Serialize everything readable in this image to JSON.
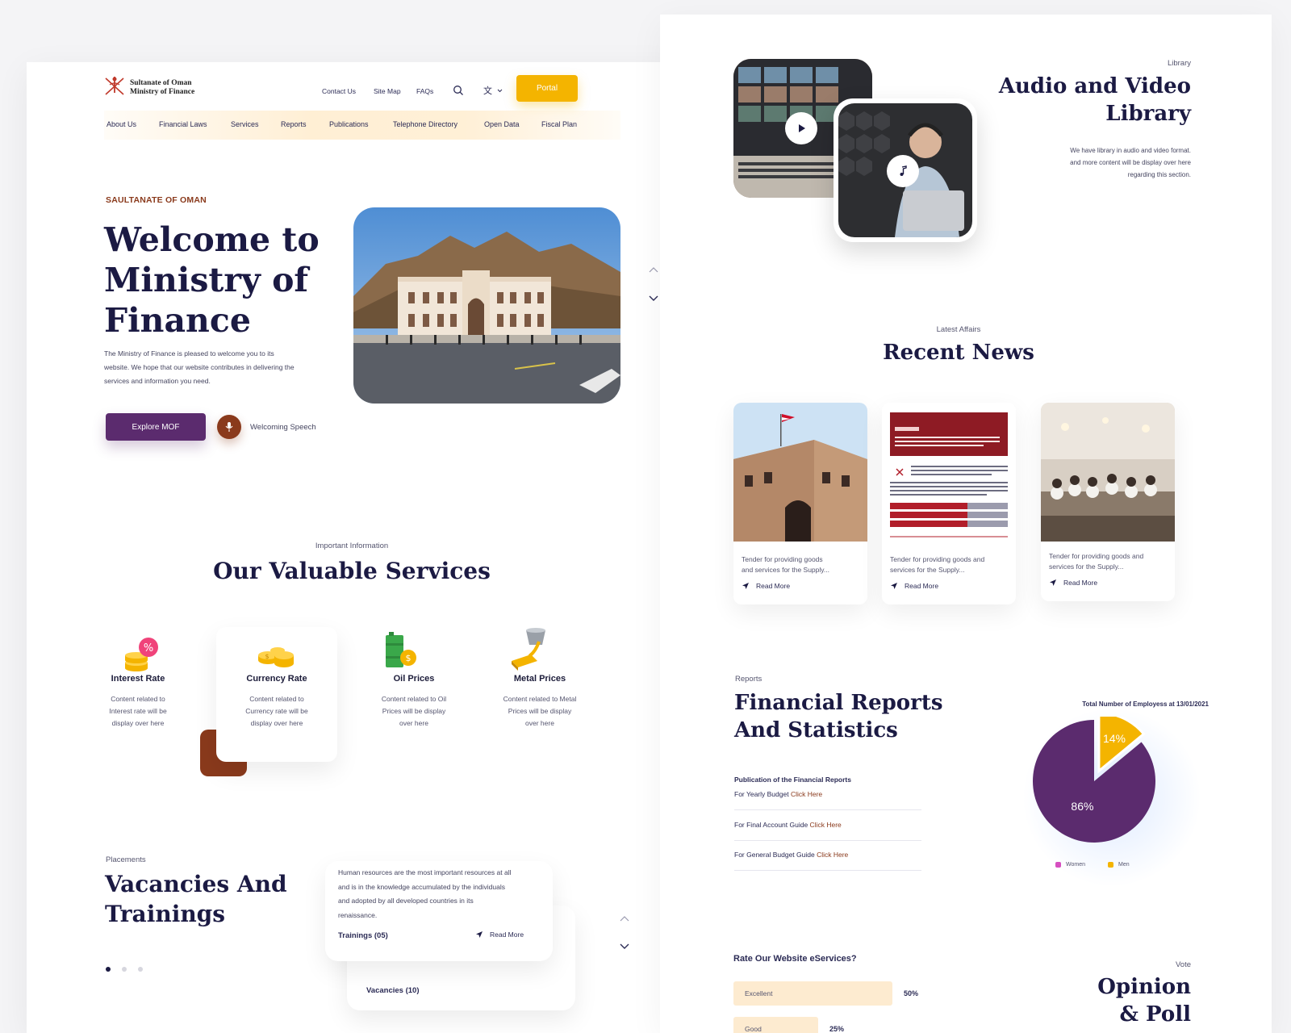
{
  "header": {
    "logo_line1": "Sultanate of Oman",
    "logo_line2": "Ministry of Finance",
    "top_links": [
      "Contact Us",
      "Site Map",
      "FAQs"
    ],
    "portal_label": "Portal",
    "nav": [
      "About Us",
      "Financial Laws",
      "Services",
      "Reports",
      "Publications",
      "Telephone Directory",
      "Open Data",
      "Fiscal Plan"
    ]
  },
  "hero": {
    "eyebrow": "SAULTANATE OF OMAN",
    "title_line1": "Welcome to",
    "title_line2": "Ministry of",
    "title_line3": "Finance",
    "desc_line1": "The Ministry of Finance is pleased to welcome you to its",
    "desc_line2": "website. We hope that our website contributes in delivering the",
    "desc_line3": "services and information you need.",
    "explore_label": "Explore MOF",
    "speech_label": "Welcoming Speech"
  },
  "services": {
    "eyebrow": "Important Information",
    "title": "Our Valuable Services",
    "items": [
      {
        "title": "Interest Rate",
        "d1": "Content related to",
        "d2": "Interest rate will  be",
        "d3": "display over here"
      },
      {
        "title": "Currency Rate",
        "d1": "Content related to",
        "d2": "Currency rate will be",
        "d3": "display over here"
      },
      {
        "title": "Oil Prices",
        "d1": "Content related to Oil",
        "d2": "Prices will be display",
        "d3": "over here"
      },
      {
        "title": "Metal Prices",
        "d1": "Content related to Metal",
        "d2": "Prices will be display",
        "d3": "over here"
      }
    ]
  },
  "vacancies": {
    "eyebrow": "Placements",
    "title_line1": "Vacancies And",
    "title_line2": "Trainings",
    "card_l1": "Human resources are the most important resources at all",
    "card_l2": "and is in the knowledge accumulated by the individuals",
    "card_l3": "and adopted by all developed countries in its",
    "card_l4": "renaissance.",
    "trainings_label": "Trainings (05)",
    "read_more": "Read More",
    "vacancies_label": "Vacancies (10)"
  },
  "library": {
    "eyebrow": "Library",
    "title_line1": "Audio and Video",
    "title_line2": "Library",
    "desc_line1": "We have library in audio and video format.",
    "desc_line2": "and more content will be display over here",
    "desc_line3": "regarding this section."
  },
  "news": {
    "eyebrow": "Latest Affairs",
    "title": "Recent News",
    "items": [
      {
        "l1": "Tender for providing goods",
        "l2": "and services for the Supply...",
        "read": "Read More"
      },
      {
        "l1": "Tender for providing goods and",
        "l2": "services for the Supply...",
        "read": "Read More"
      },
      {
        "l1": "Tender for providing goods and",
        "l2": "services for the Supply...",
        "read": "Read More"
      }
    ]
  },
  "reports": {
    "eyebrow": "Reports",
    "title_line1": "Financial Reports",
    "title_line2": "And Statistics",
    "pub_heading": "Publication of the Financial Reports",
    "links": [
      {
        "text": "For Yearly Budget ",
        "cta": "Click Here"
      },
      {
        "text": "For Final Account Guide ",
        "cta": "Click Here"
      },
      {
        "text": "For General Budget Guide ",
        "cta": "Click Here"
      }
    ]
  },
  "chart_data": {
    "type": "pie",
    "title": "Total Number of Employess at 13/01/2021",
    "categories": [
      "Women",
      "Men"
    ],
    "values": [
      86,
      14
    ],
    "labels": [
      "86%",
      "14%"
    ],
    "colors": [
      "#5b2b6e",
      "#f4b400"
    ],
    "legend_colors": [
      "#d64fc0",
      "#f4b400"
    ],
    "legend_position": "bottom"
  },
  "poll": {
    "question": "Rate Our Website eServices?",
    "eyebrow": "Vote",
    "title_line1": "Opinion",
    "title_line2": "& Poll",
    "options": [
      {
        "label": "Excellent",
        "pct": "50%",
        "value": 0.5
      },
      {
        "label": "Good",
        "pct": "25%",
        "value": 0.25
      }
    ]
  }
}
